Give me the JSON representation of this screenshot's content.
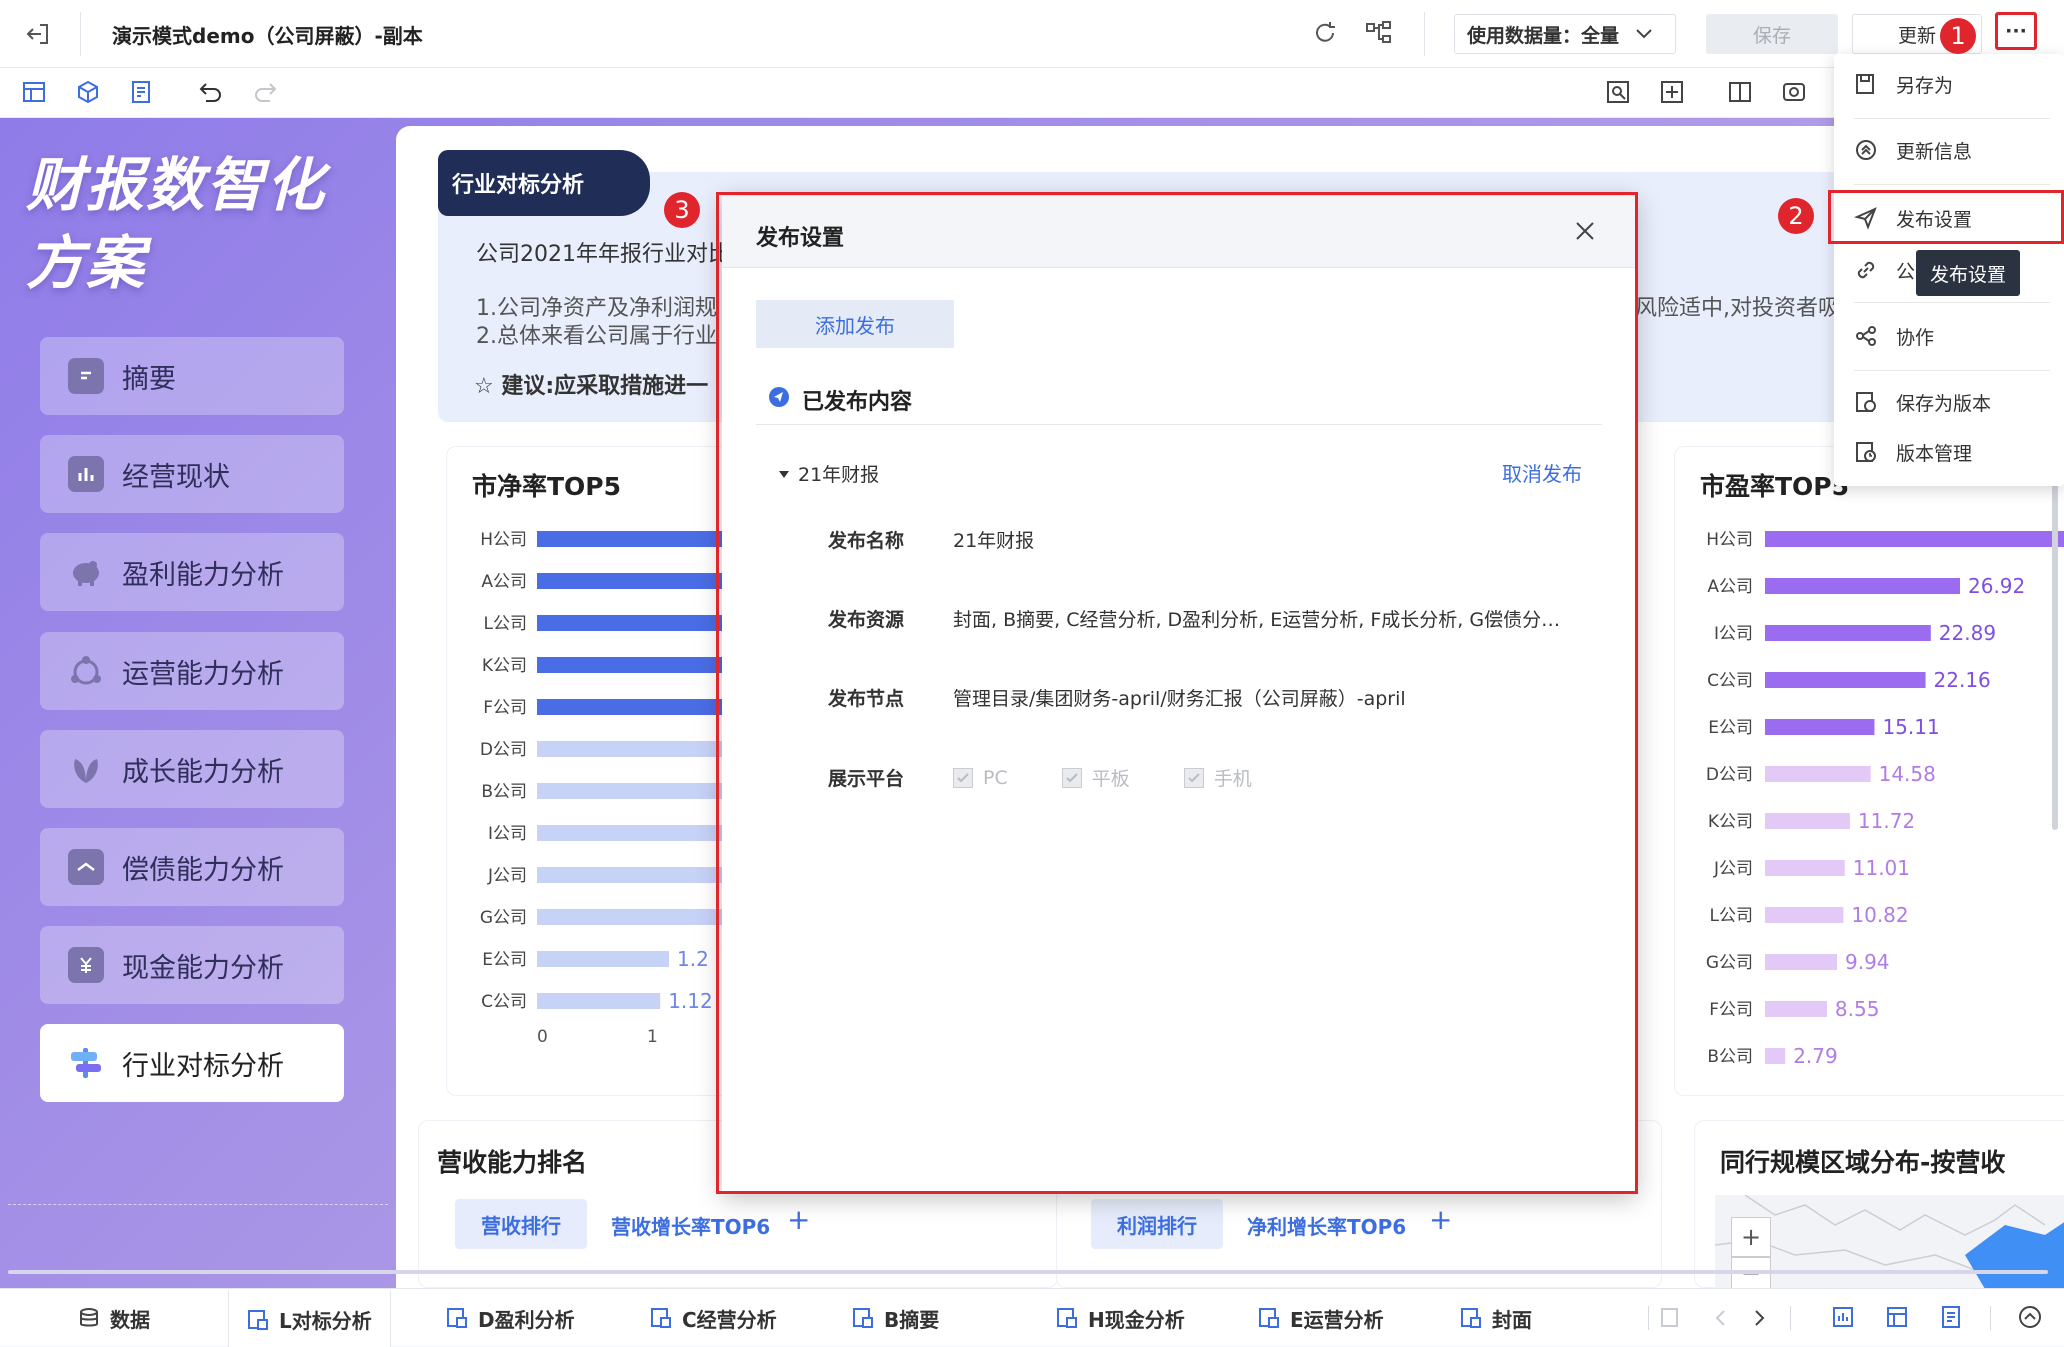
{
  "header": {
    "title": "演示模式demo（公司屏蔽）-副本",
    "data_usage_label": "使用数据量：全量",
    "save_label": "保存",
    "update_label": "更新",
    "more_label": "···"
  },
  "sidebar": {
    "title_line1": "财报数智化",
    "title_line2": "方案",
    "items": [
      {
        "label": "摘要"
      },
      {
        "label": "经营现状"
      },
      {
        "label": "盈利能力分析"
      },
      {
        "label": "运营能力分析"
      },
      {
        "label": "成长能力分析"
      },
      {
        "label": "偿债能力分析"
      },
      {
        "label": "现金能力分析"
      },
      {
        "label": "行业对标分析"
      }
    ]
  },
  "summary": {
    "tag": "行业对标分析",
    "line1": "公司2021年年报行业对比",
    "line2": "1.公司净资产及净利润规",
    "line3": "2.总体来看公司属于行业",
    "line4": "☆ 建议:应采取措施进一",
    "right_text": "风险适中,对投资者吸"
  },
  "pb_chart": {
    "title": "市净率TOP5",
    "ticks": [
      "0",
      "1"
    ]
  },
  "pe_chart": {
    "title": "市盈率TOP5"
  },
  "chart_data": [
    {
      "type": "bar",
      "title": "市净率TOP5",
      "categories": [
        "H公司",
        "A公司",
        "L公司",
        "K公司",
        "F公司",
        "D公司",
        "B公司",
        "I公司",
        "J公司",
        "G公司",
        "E公司",
        "C公司"
      ],
      "values": [
        null,
        null,
        null,
        null,
        null,
        null,
        null,
        null,
        null,
        null,
        1.2,
        1.12
      ],
      "value_labels": [
        "",
        "",
        "",
        "",
        "",
        "",
        "",
        "",
        "",
        "",
        "1.2",
        "1.12"
      ],
      "xlim": [
        0,
        1.6
      ],
      "highlight_top": 5
    },
    {
      "type": "bar",
      "title": "市盈率TOP5",
      "categories": [
        "H公司",
        "A公司",
        "I公司",
        "C公司",
        "E公司",
        "D公司",
        "K公司",
        "J公司",
        "L公司",
        "G公司",
        "F公司",
        "B公司"
      ],
      "values": [
        null,
        26.92,
        22.89,
        22.16,
        15.11,
        14.58,
        11.72,
        11.01,
        10.82,
        9.94,
        8.55,
        2.79
      ],
      "value_labels": [
        "",
        "26.92",
        "22.89",
        "22.16",
        "15.11",
        "14.58",
        "11.72",
        "11.01",
        "10.82",
        "9.94",
        "8.55",
        "2.79"
      ],
      "highlight_top": 5
    }
  ],
  "revenue_card": {
    "title": "营收能力排名",
    "tab1": "营收排行",
    "tab2": "营收增长率TOP6",
    "add": "+"
  },
  "profit_card": {
    "tab1": "利润排行",
    "tab2": "净利增长率TOP6",
    "add": "+"
  },
  "region_card": {
    "title": "同行规模区域分布-按营收",
    "zoom_in": "+",
    "zoom_out": "−"
  },
  "menu": {
    "items": [
      {
        "label": "另存为"
      },
      {
        "label": "更新信息"
      },
      {
        "label": "发布设置"
      },
      {
        "label": "公"
      },
      {
        "label": "协作"
      },
      {
        "label": "保存为版本"
      },
      {
        "label": "版本管理"
      }
    ],
    "tooltip": "发布设置"
  },
  "dialog": {
    "title": "发布设置",
    "add_button": "添加发布",
    "section_title": "已发布内容",
    "item_name": "21年财报",
    "cancel_link": "取消发布",
    "fields": {
      "name_label": "发布名称",
      "name_value": "21年财报",
      "resource_label": "发布资源",
      "resource_value": "封面, B摘要, C经营分析, D盈利分析, E运营分析, F成长分析, G偿债分…",
      "node_label": "发布节点",
      "node_value": "管理目录/集团财务-april/财务汇报（公司屏蔽）-april",
      "platform_label": "展示平台",
      "platforms": [
        "PC",
        "平板",
        "手机"
      ]
    }
  },
  "badges": [
    "1",
    "2",
    "3"
  ],
  "bottom_tabs": {
    "data_label": "数据",
    "tabs": [
      "L对标分析",
      "D盈利分析",
      "C经营分析",
      "B摘要",
      "H现金分析",
      "E运营分析",
      "封面"
    ]
  }
}
